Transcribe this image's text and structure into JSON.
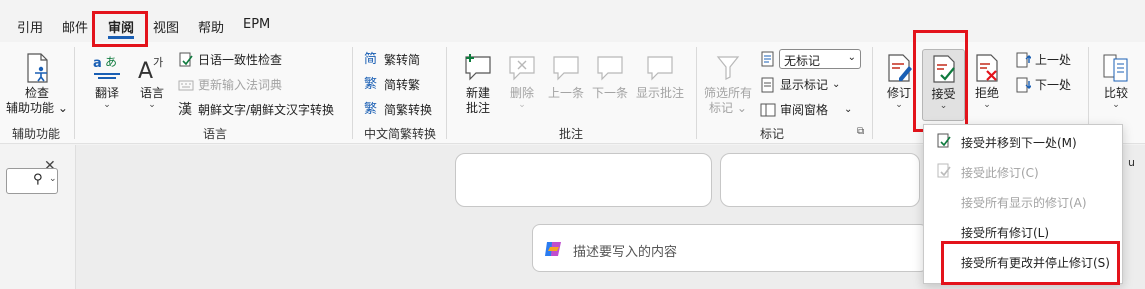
{
  "tabs": [
    "引用",
    "邮件",
    "审阅",
    "视图",
    "帮助",
    "EPM"
  ],
  "ribbon": {
    "accessibility": {
      "button": "检查",
      "button2": "辅助功能",
      "group": "辅助功能"
    },
    "language": {
      "translate": "翻译",
      "language": "语言",
      "consistency": "日语一致性检查",
      "ime_dictionary": "更新输入法词典",
      "korean_convert": "朝鲜文字/朝鲜文汉字转换",
      "group": "语言"
    },
    "chinese": {
      "trad_to_simp": "繁转简",
      "simp_to_trad": "简转繁",
      "convert": "简繁转换",
      "group": "中文简繁转换"
    },
    "comments": {
      "new": "新建",
      "new2": "批注",
      "delete": "删除",
      "previous": "上一条",
      "next": "下一条",
      "show": "显示批注",
      "group": "批注"
    },
    "tracking": {
      "filter": "筛选所有",
      "filter2": "标记",
      "markup_select": "无标记",
      "show_markup": "显示标记",
      "review_pane": "审阅窗格",
      "track": "修订",
      "group": "标记"
    },
    "changes": {
      "accept": "接受",
      "reject": "拒绝",
      "previous": "上一处",
      "next": "下一处"
    },
    "compare": {
      "button": "比较"
    }
  },
  "document": {
    "prompt_placeholder": "描述要写入的内容"
  },
  "accept_menu": {
    "items": [
      {
        "label": "接受并移到下一处(M)",
        "enabled": true
      },
      {
        "label": "接受此修订(C)",
        "enabled": false
      },
      {
        "label": "接受所有显示的修订(A)",
        "enabled": false
      },
      {
        "label": "接受所有修订(L)",
        "enabled": true
      },
      {
        "label": "接受所有更改并停止修订(S)",
        "enabled": true
      }
    ]
  },
  "colors": {
    "highlight": "#e3131b",
    "accent": "#1a5fb4",
    "disabled": "#a3a3a3"
  }
}
